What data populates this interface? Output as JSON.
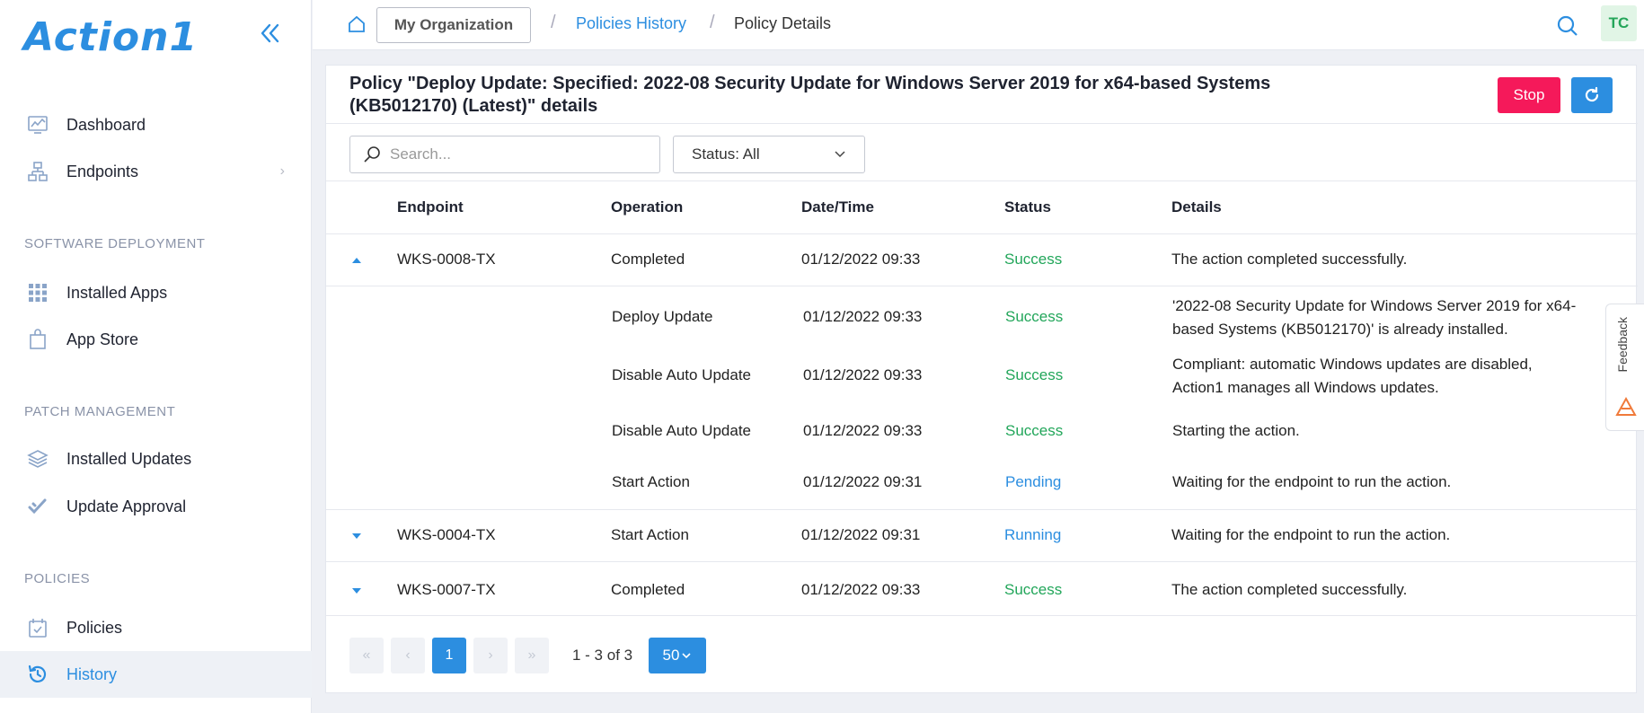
{
  "app": {
    "logo": "Action1"
  },
  "sidebar": {
    "items": [
      {
        "label": "Dashboard",
        "icon": "dashboard-icon"
      },
      {
        "label": "Endpoints",
        "icon": "endpoints-icon"
      },
      {
        "label": "Installed Apps",
        "icon": "grid-icon"
      },
      {
        "label": "App Store",
        "icon": "shopping-bag-icon"
      },
      {
        "label": "Installed Updates",
        "icon": "layers-icon"
      },
      {
        "label": "Update Approval",
        "icon": "double-check-icon"
      },
      {
        "label": "Policies",
        "icon": "calendar-check-icon"
      },
      {
        "label": "History",
        "icon": "history-icon"
      }
    ],
    "sections": {
      "software": "SOFTWARE DEPLOYMENT",
      "patch": "PATCH MANAGEMENT",
      "policies": "POLICIES"
    },
    "active": "History"
  },
  "breadcrumb": {
    "org": "My Organization",
    "link": "Policies History",
    "current": "Policy Details"
  },
  "user": {
    "initials": "TC"
  },
  "page": {
    "title": "Policy \"Deploy Update: Specified: 2022-08 Security Update for Windows Server 2019 for x64-based Systems (KB5012170) (Latest)\" details",
    "stop_label": "Stop"
  },
  "filters": {
    "search_placeholder": "Search...",
    "status_label": "Status: All"
  },
  "table": {
    "headers": [
      "Endpoint",
      "Operation",
      "Date/Time",
      "Status",
      "Details"
    ],
    "rows": [
      {
        "endpoint": "WKS-0008-TX",
        "operation": "Completed",
        "datetime": "01/12/2022 09:33",
        "status": "Success",
        "details": "The action completed successfully.",
        "expanded": true
      },
      {
        "endpoint": "",
        "operation": "Deploy Update",
        "datetime": "01/12/2022 09:33",
        "status": "Success",
        "details": "'2022-08 Security Update for Windows Server 2019 for x64-based Systems (KB5012170)' is already installed."
      },
      {
        "endpoint": "",
        "operation": "Disable Auto Update",
        "datetime": "01/12/2022 09:33",
        "status": "Success",
        "details": "Compliant: automatic Windows updates are disabled, Action1 manages all Windows updates."
      },
      {
        "endpoint": "",
        "operation": "Disable Auto Update",
        "datetime": "01/12/2022 09:33",
        "status": "Success",
        "details": "Starting the action."
      },
      {
        "endpoint": "",
        "operation": "Start Action",
        "datetime": "01/12/2022 09:31",
        "status": "Pending",
        "details": "Waiting for the endpoint to run the action."
      },
      {
        "endpoint": "WKS-0004-TX",
        "operation": "Start Action",
        "datetime": "01/12/2022 09:31",
        "status": "Running",
        "details": "Waiting for the endpoint to run the action.",
        "expanded": false
      },
      {
        "endpoint": "WKS-0007-TX",
        "operation": "Completed",
        "datetime": "01/12/2022 09:33",
        "status": "Success",
        "details": "The action completed successfully.",
        "expanded": false
      }
    ]
  },
  "pagination": {
    "current_page": "1",
    "range": "1 - 3 of 3",
    "per_page": "50"
  },
  "feedback": {
    "label": "Feedback"
  },
  "colors": {
    "accent": "#2c8ee0",
    "danger": "#f5195a",
    "success": "#22a65a"
  }
}
